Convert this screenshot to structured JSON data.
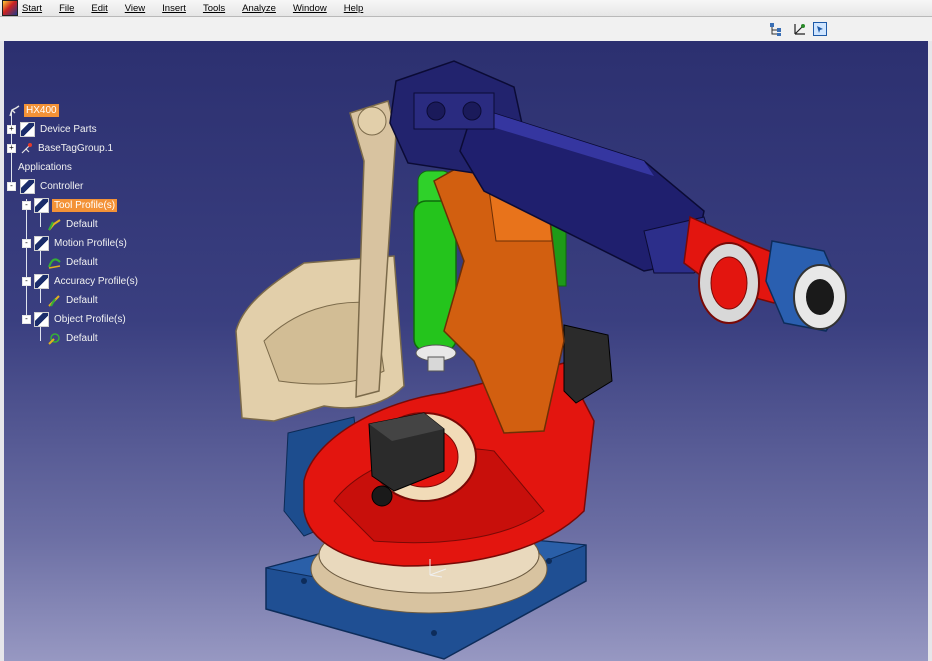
{
  "menu": {
    "items": [
      "Start",
      "File",
      "Edit",
      "View",
      "Insert",
      "Tools",
      "Analyze",
      "Window",
      "Help"
    ]
  },
  "toolbar": {
    "icons": [
      "tree-structure-icon",
      "axis-compass-icon",
      "view-select-icon"
    ]
  },
  "tree": {
    "root": "HX400",
    "device_parts": "Device Parts",
    "base_tag_group": "BaseTagGroup.1",
    "applications": "Applications",
    "controller": "Controller",
    "profiles": [
      {
        "label": "Tool Profile(s)",
        "child": "Default",
        "selected": true
      },
      {
        "label": "Motion Profile(s)",
        "child": "Default",
        "selected": false
      },
      {
        "label": "Accuracy Profile(s)",
        "child": "Default",
        "selected": false
      },
      {
        "label": "Object Profile(s)",
        "child": "Default",
        "selected": false
      }
    ]
  },
  "colors": {
    "selection": "#f39237",
    "background_top": "#2c3070",
    "background_bottom": "#9798c2",
    "arm_blue": "#1f1f6e",
    "link_orange": "#d25f10",
    "base_red": "#e3150f",
    "cylinder_green": "#24c41c",
    "counterweight_tan": "#e2cfaa",
    "baseplate_blue": "#1f4f93"
  }
}
